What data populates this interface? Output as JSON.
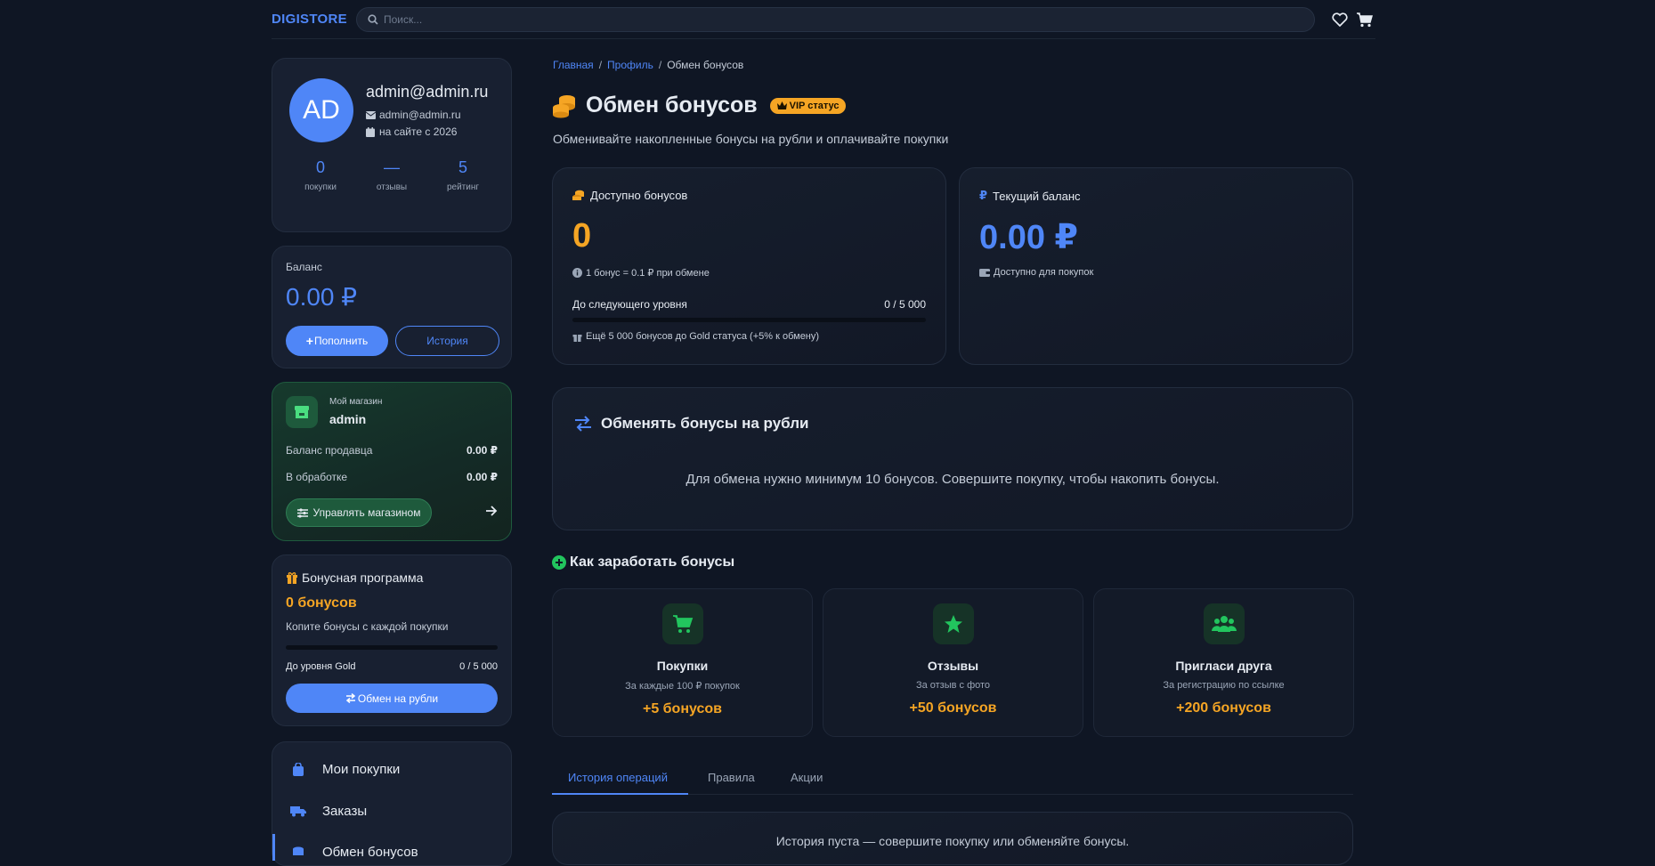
{
  "header": {
    "logo": "DIGISTORE",
    "search_placeholder": "Поиск..."
  },
  "profile": {
    "initials": "AD",
    "name": "admin@admin.ru",
    "email": "admin@admin.ru",
    "since": "на сайте с 2026",
    "stats": [
      {
        "value": "0",
        "label": "покупки"
      },
      {
        "value": "—",
        "label": "отзывы"
      },
      {
        "value": "5",
        "label": "рейтинг"
      }
    ]
  },
  "balance_card": {
    "title": "Баланс",
    "amount": "0.00 ₽",
    "topup_label": "Пополнить",
    "history_label": "История"
  },
  "shop_card": {
    "caption": "Мой магазин",
    "name": "admin",
    "rows": [
      {
        "label": "Баланс продавца",
        "value": "0.00 ₽"
      },
      {
        "label": "В обработке",
        "value": "0.00 ₽"
      }
    ],
    "manage_label": "Управлять магазином"
  },
  "bonus_card": {
    "title": "Бонусная программа",
    "amount": "0 бонусов",
    "subtitle": "Копите бонусы с каждой покупки",
    "progress_label": "До уровня Gold",
    "progress_value": "0 / 5 000",
    "progress_fraction": 0,
    "exchange_label": "Обмен на рубли"
  },
  "side_menu": [
    {
      "label": "Мои покупки",
      "icon": "bag-icon"
    },
    {
      "label": "Заказы",
      "icon": "truck-icon"
    },
    {
      "label": "Обмен бонусов",
      "icon": "coins-icon"
    }
  ],
  "breadcrumb": [
    "Главная",
    "Профиль",
    "Обмен бонусов"
  ],
  "page": {
    "title": "Обмен бонусов",
    "vip_badge": "VIP статус",
    "subtitle": "Обменивайте накопленные бонусы на рубли и оплачивайте покупки"
  },
  "available": {
    "title": "Доступно бонусов",
    "value": "0",
    "rate": "1 бонус = 0.1 ₽ при обмене",
    "level_label": "До следующего уровня",
    "level_value": "0 / 5 000",
    "level_fraction": 0,
    "hint": "Ещё 5 000 бонусов до Gold статуса (+5% к обмену)"
  },
  "current": {
    "title": "Текущий баланс",
    "value": "0.00 ₽",
    "note": "Доступно для покупок"
  },
  "exchange": {
    "title": "Обменять бонусы на рубли",
    "message": "Для обмена нужно минимум 10 бонусов. Совершите покупку, чтобы накопить бонусы."
  },
  "earn": {
    "title": "Как заработать бонусы",
    "items": [
      {
        "title": "Покупки",
        "desc": "За каждые 100 ₽ покупок",
        "bonus": "+5 бонусов",
        "icon": "cart-icon"
      },
      {
        "title": "Отзывы",
        "desc": "За отзыв с фото",
        "bonus": "+50 бонусов",
        "icon": "star-icon"
      },
      {
        "title": "Пригласи друга",
        "desc": "За регистрацию по ссылке",
        "bonus": "+200 бонусов",
        "icon": "users-icon"
      }
    ]
  },
  "tabs": [
    {
      "label": "История операций",
      "active": true
    },
    {
      "label": "Правила",
      "active": false
    },
    {
      "label": "Акции",
      "active": false
    }
  ],
  "history_empty": "История пуста — совершите покупку или обменяйте бонусы.",
  "colors": {
    "accent": "#4f86f7",
    "bonus": "#f5a524",
    "success": "#22c55e",
    "background": "#0f1624"
  }
}
